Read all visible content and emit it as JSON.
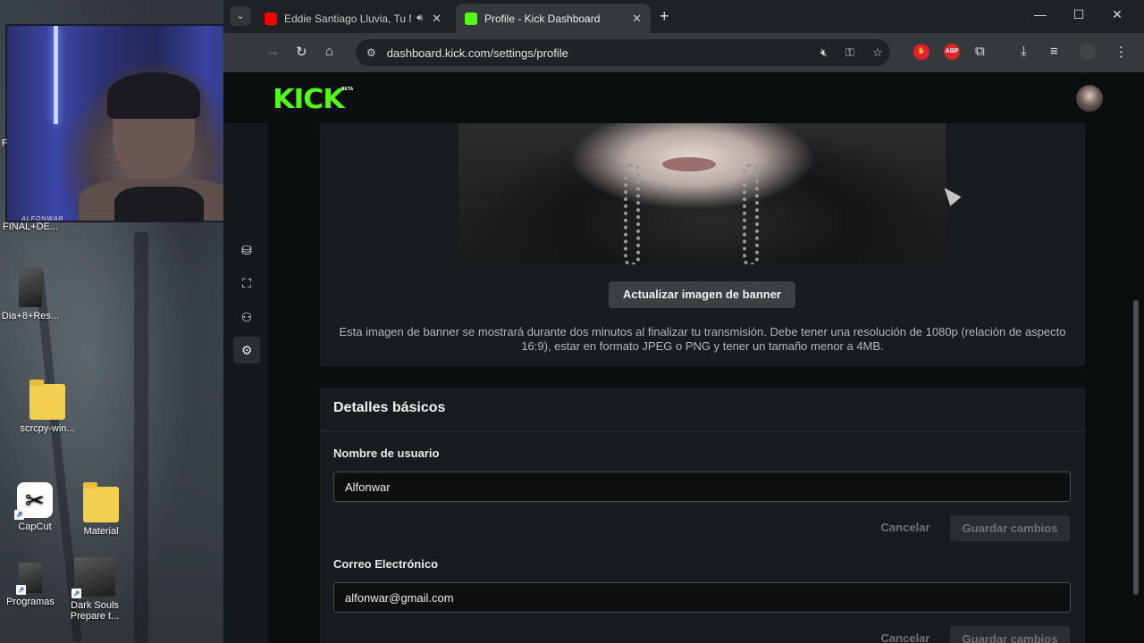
{
  "desktop": {
    "webcam_caption": "ALFONWAR",
    "side_label": "F",
    "icons": [
      {
        "label": "FINAL+DE..."
      },
      {
        "label": "Dia+8+Res..."
      },
      {
        "label": "scrcpy-win..."
      },
      {
        "label": "CapCut"
      },
      {
        "label": "Material"
      },
      {
        "label": "Programas"
      },
      {
        "label": "Dark Souls Prepare t..."
      }
    ]
  },
  "browser": {
    "tabs": [
      {
        "title": "Eddie Santiago Lluvia, Tu M",
        "favicon": "youtube-icon",
        "favicon_color": "#ff0000",
        "audio": "speaker-icon"
      },
      {
        "title": "Profile - Kick Dashboard",
        "favicon": "kick-icon",
        "favicon_color": "#53fc18"
      }
    ],
    "new_tab_glyph": "+",
    "url": "dashboard.kick.com/settings/profile",
    "extensions": [
      {
        "name": "red-hand-extension",
        "color": "#e5202c"
      },
      {
        "name": "adblock-plus-extension",
        "label": "ABP",
        "color": "#d9252b"
      }
    ]
  },
  "kick": {
    "logo": "KICK",
    "beta": "BETA",
    "accent": "#53fc18",
    "rail": [
      "dashboard-icon",
      "screen-icon",
      "users-icon",
      "gear-icon"
    ],
    "banner": {
      "update_button": "Actualizar imagen de banner",
      "help": "Esta imagen de banner se mostrará durante dos minutos al finalizar tu transmisión. Debe tener una resolución de 1080p (relación de aspecto 16:9), estar en formato JPEG o PNG y tener un tamaño menor a 4MB."
    },
    "basic": {
      "title": "Detalles básicos",
      "username_label": "Nombre de usuario",
      "username_value": "Alfonwar",
      "cancel": "Cancelar",
      "save": "Guardar cambios",
      "email_label": "Correo Electrónico",
      "email_value": "alfonwar@gmail.com"
    }
  }
}
